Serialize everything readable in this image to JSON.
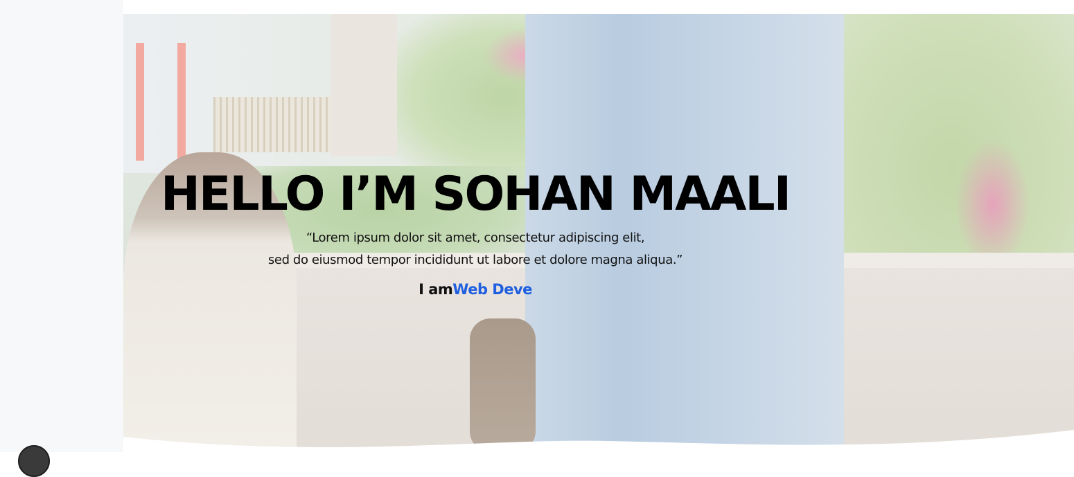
{
  "hero": {
    "title": "HELLO I’M SOHAN MAALI",
    "quote_line1": "“Lorem ipsum dolor sit amet, consectetur adipiscing elit,",
    "quote_line2": "sed do eiusmod tempor incididunt ut labore et dolore magna aliqua.”",
    "role_prefix": "I am",
    "role_typed": "Web Deve"
  },
  "colors": {
    "title": "#000000",
    "role_accent": "#1f5fe0",
    "sidebar_bg": "#f7f8fa"
  }
}
